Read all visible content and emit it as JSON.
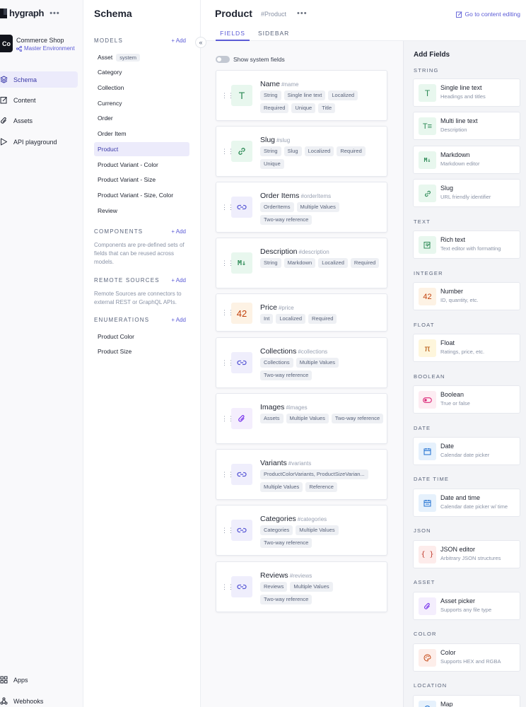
{
  "nav": {
    "logo": "hygraph",
    "project": {
      "initials": "Co",
      "name": "Commerce Shop",
      "environment": "Master Environment"
    },
    "items": [
      {
        "label": "Schema",
        "icon": "schema-icon"
      },
      {
        "label": "Content",
        "icon": "edit-icon"
      },
      {
        "label": "Assets",
        "icon": "paperclip-icon"
      },
      {
        "label": "API playground",
        "icon": "play-icon"
      }
    ],
    "bottom": [
      {
        "label": "Apps",
        "icon": "apps-icon"
      },
      {
        "label": "Webhooks",
        "icon": "webhook-icon"
      }
    ]
  },
  "schema": {
    "title": "Schema",
    "models_label": "MODELS",
    "add_label": "+ Add",
    "models": [
      {
        "label": "Asset",
        "tag": "system"
      },
      {
        "label": "Category"
      },
      {
        "label": "Collection"
      },
      {
        "label": "Currency"
      },
      {
        "label": "Order"
      },
      {
        "label": "Order Item"
      },
      {
        "label": "Product"
      },
      {
        "label": "Product Variant - Color"
      },
      {
        "label": "Product Variant - Size"
      },
      {
        "label": "Product Variant - Size, Color"
      },
      {
        "label": "Review"
      }
    ],
    "components_label": "COMPONENTS",
    "components_desc": "Components are pre-defined sets of fields that can be reused across models.",
    "remote_label": "REMOTE SOURCES",
    "remote_desc": "Remote Sources are connectors to external REST or GraphQL APIs.",
    "enums_label": "ENUMERATIONS",
    "enums": [
      "Product Color",
      "Product Size"
    ]
  },
  "header": {
    "title": "Product",
    "api_id": "#Product",
    "link": "Go to content editing",
    "tabs": [
      "FIELDS",
      "SIDEBAR"
    ]
  },
  "toggle_label": "Show system fields",
  "fields": [
    {
      "name": "Name",
      "api": "#name",
      "icon": "text-icon",
      "tags": [
        "String",
        "Single line text",
        "Localized",
        "Required",
        "Unique",
        "Title"
      ]
    },
    {
      "name": "Slug",
      "api": "#slug",
      "icon": "slug-icon",
      "tags": [
        "String",
        "Slug",
        "Localized",
        "Required",
        "Unique"
      ]
    },
    {
      "name": "Order Items",
      "api": "#orderItems",
      "icon": "reference-icon",
      "tags": [
        "OrderItems",
        "Multiple Values",
        "Two-way reference"
      ]
    },
    {
      "name": "Description",
      "api": "#description",
      "icon": "markdown-icon",
      "tags": [
        "String",
        "Markdown",
        "Localized",
        "Required"
      ]
    },
    {
      "name": "Price",
      "api": "#price",
      "icon": "number-icon",
      "tags": [
        "Int",
        "Localized",
        "Required"
      ]
    },
    {
      "name": "Collections",
      "api": "#collections",
      "icon": "reference-icon",
      "tags": [
        "Collections",
        "Multiple Values",
        "Two-way reference"
      ]
    },
    {
      "name": "Images",
      "api": "#images",
      "icon": "asset-icon",
      "tags": [
        "Assets",
        "Multiple Values",
        "Two-way reference"
      ]
    },
    {
      "name": "Variants",
      "api": "#variants",
      "icon": "reference-icon",
      "tags": [
        "ProductColorVariants, ProductSizeVarian...",
        "Multiple Values",
        "Reference"
      ]
    },
    {
      "name": "Categories",
      "api": "#categories",
      "icon": "reference-icon",
      "tags": [
        "Categories",
        "Multiple Values",
        "Two-way reference"
      ]
    },
    {
      "name": "Reviews",
      "api": "#reviews",
      "icon": "reference-icon",
      "tags": [
        "Reviews",
        "Multiple Values",
        "Two-way reference"
      ]
    }
  ],
  "add_fields": {
    "title": "Add Fields",
    "groups": [
      {
        "label": "STRING",
        "items": [
          {
            "name": "Single line text",
            "desc": "Headings and titles",
            "icon": "text-icon"
          },
          {
            "name": "Multi line text",
            "desc": "Description",
            "icon": "multiline-icon"
          },
          {
            "name": "Markdown",
            "desc": "Markdown editor",
            "icon": "markdown-icon"
          },
          {
            "name": "Slug",
            "desc": "URL friendly identifier",
            "icon": "slug-icon"
          }
        ]
      },
      {
        "label": "TEXT",
        "items": [
          {
            "name": "Rich text",
            "desc": "Text editor with formatting",
            "icon": "richtext-icon"
          }
        ]
      },
      {
        "label": "INTEGER",
        "items": [
          {
            "name": "Number",
            "desc": "ID, quantity, etc.",
            "icon": "number-icon"
          }
        ]
      },
      {
        "label": "FLOAT",
        "items": [
          {
            "name": "Float",
            "desc": "Ratings, price, etc.",
            "icon": "pi-icon"
          }
        ]
      },
      {
        "label": "BOOLEAN",
        "items": [
          {
            "name": "Boolean",
            "desc": "True or false",
            "icon": "toggle-icon"
          }
        ]
      },
      {
        "label": "DATE",
        "items": [
          {
            "name": "Date",
            "desc": "Calendar date picker",
            "icon": "calendar-icon"
          }
        ]
      },
      {
        "label": "DATE TIME",
        "items": [
          {
            "name": "Date and time",
            "desc": "Calendar date picker w/ time",
            "icon": "calendar-time-icon"
          }
        ]
      },
      {
        "label": "JSON",
        "items": [
          {
            "name": "JSON editor",
            "desc": "Arbitrary JSON structures",
            "icon": "json-icon"
          }
        ]
      },
      {
        "label": "ASSET",
        "items": [
          {
            "name": "Asset picker",
            "desc": "Supports any file type",
            "icon": "asset-icon"
          }
        ]
      },
      {
        "label": "COLOR",
        "items": [
          {
            "name": "Color",
            "desc": "Supports HEX and RGBA",
            "icon": "palette-icon"
          }
        ]
      },
      {
        "label": "LOCATION",
        "items": [
          {
            "name": "Map",
            "desc": "",
            "icon": "map-icon"
          }
        ]
      }
    ]
  }
}
